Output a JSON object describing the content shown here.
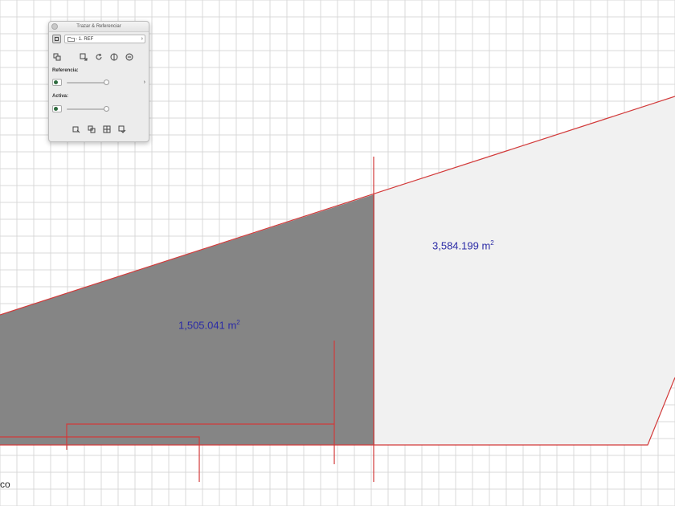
{
  "palette": {
    "title": "Trazar & Referenciar",
    "layer_name": "- 1. REF",
    "referencia_label": "Referencia:",
    "activa_label": "Activa:",
    "icons": {
      "mode": "square-mode-icon",
      "layer": "folder-icon",
      "layer_chevron": "chevron-right-icon",
      "row2": [
        "overlay-icon",
        "move-reference-icon",
        "rotate-reference-icon",
        "mirror-reference-icon",
        "reset-icon"
      ],
      "row_bottom": [
        "switch-icon",
        "swap-icon",
        "compare-icon",
        "options-icon"
      ]
    },
    "referencia_slider": 0.92,
    "activa_slider": 0.92
  },
  "areas": {
    "left_value": "1,505.041 m",
    "left_sup": "2",
    "right_value": "3,584.199 m",
    "right_sup": "2"
  },
  "corner_text": "co",
  "colors": {
    "grid": "#d9d9d9",
    "red_line": "#d23a3a",
    "dark_fill": "#858585",
    "light_fill": "#f1f1f1",
    "area_text": "#2b2ba6"
  }
}
